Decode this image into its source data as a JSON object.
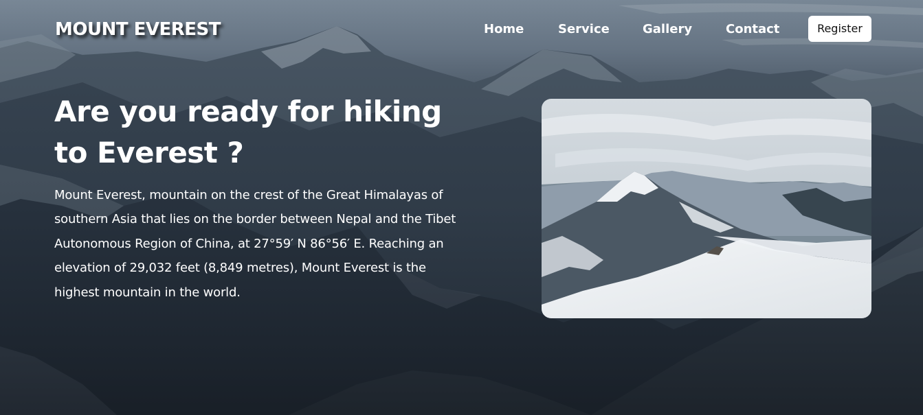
{
  "navbar": {
    "brand": "MOUNT EVEREST",
    "links": [
      {
        "label": "Home"
      },
      {
        "label": "Service"
      },
      {
        "label": "Gallery"
      },
      {
        "label": "Contact"
      }
    ],
    "register_label": "Register"
  },
  "hero": {
    "title": "Are you ready for hiking to Everest ?",
    "description": "Mount Everest, mountain on the crest of the Great Himalayas of southern Asia that lies on the border between Nepal and the Tibet Autonomous Region of China, at 27°59′ N 86°56′ E. Reaching an elevation of 29,032 feet (8,849 metres), Mount Everest is the highest mountain in the world."
  },
  "images": {
    "background": "mountain-range-background",
    "feature": "snowy-mountain-photo"
  },
  "colors": {
    "text": "#ffffff",
    "button_bg": "#ffffff",
    "button_text": "#111111"
  }
}
